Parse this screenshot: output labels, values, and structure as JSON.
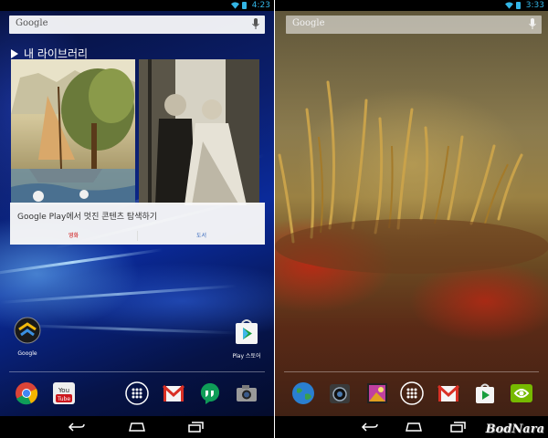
{
  "left": {
    "status": {
      "time": "4:23"
    },
    "search": {
      "label": "Google"
    },
    "library": {
      "title": "내 라이브러리",
      "promo_text": "Google Play에서 멋진 콘텐츠 탐색하기",
      "actions": [
        "영화",
        "도서"
      ]
    },
    "home": {
      "google_label": "Google",
      "playstore_label": "Play 스토어"
    }
  },
  "right": {
    "status": {
      "time": "3:33"
    },
    "search": {
      "label": "Google"
    },
    "watermark": "BodNara"
  },
  "colors": {
    "status_accent": "#33b5e5",
    "popup_action_red": "#cc0000",
    "popup_action_blue": "#3366bb"
  }
}
